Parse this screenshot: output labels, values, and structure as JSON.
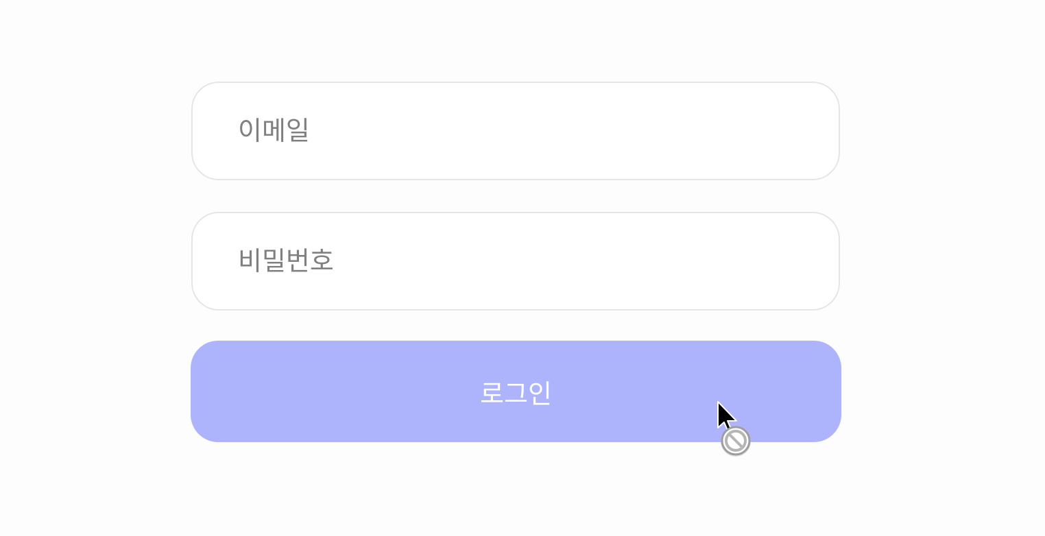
{
  "login_form": {
    "email_placeholder": "이메일",
    "password_placeholder": "비밀번호",
    "login_label": "로그인"
  },
  "colors": {
    "button_bg": "#adb4fc",
    "button_text": "#ffffff",
    "input_border": "#e4e4ea",
    "placeholder": "#808080"
  },
  "cursor": {
    "icon": "not-allowed-cursor-icon"
  }
}
